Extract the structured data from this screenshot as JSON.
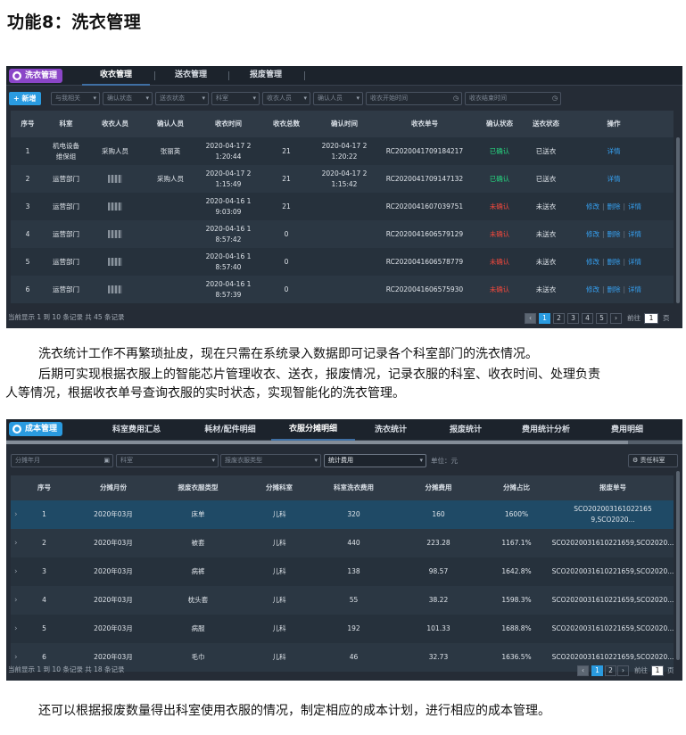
{
  "heading": "功能8：洗衣管理",
  "p1": {
    "badge": "洗衣管理",
    "tabs": [
      "收衣管理",
      "送衣管理",
      "报废管理"
    ],
    "add_btn": "+ 新增",
    "filters": [
      "与我相关",
      "确认状态",
      "送衣状态",
      "科室",
      "收衣人员",
      "确认人员",
      "收衣开始时间",
      "收衣结束时间"
    ],
    "headers": [
      "序号",
      "科室",
      "收衣人员",
      "确认人员",
      "收衣时间",
      "收衣总数",
      "确认时间",
      "收衣单号",
      "确认状态",
      "送衣状态",
      "操作"
    ],
    "rows": [
      {
        "no": "1",
        "dept": "机电设备\n维保组",
        "recv": "采购人员",
        "confirm": "张丽英",
        "time": "2020-04-17 2\n1:20:44",
        "total": "21",
        "ctime": "2020-04-17 2\n1:20:22",
        "order": "RC2020041709184217",
        "cstat": "已确认",
        "sstat": "已送衣",
        "ops": [
          "详情"
        ]
      },
      {
        "no": "2",
        "dept": "运营部门",
        "recv": "",
        "confirm": "采购人员",
        "time": "2020-04-17 2\n1:15:49",
        "total": "21",
        "ctime": "2020-04-17 2\n1:15:42",
        "order": "RC2020041709147132",
        "cstat": "已确认",
        "sstat": "已送衣",
        "ops": [
          "详情"
        ]
      },
      {
        "no": "3",
        "dept": "运营部门",
        "recv": "",
        "confirm": "",
        "time": "2020-04-16 1\n9:03:09",
        "total": "21",
        "ctime": "",
        "order": "RC2020041607039751",
        "cstat": "未确认",
        "sstat": "未送衣",
        "ops": [
          "修改",
          "删除",
          "详情"
        ]
      },
      {
        "no": "4",
        "dept": "运营部门",
        "recv": "",
        "confirm": "",
        "time": "2020-04-16 1\n8:57:42",
        "total": "0",
        "ctime": "",
        "order": "RC2020041606579129",
        "cstat": "未确认",
        "sstat": "未送衣",
        "ops": [
          "修改",
          "删除",
          "详情"
        ]
      },
      {
        "no": "5",
        "dept": "运营部门",
        "recv": "",
        "confirm": "",
        "time": "2020-04-16 1\n8:57:40",
        "total": "0",
        "ctime": "",
        "order": "RC2020041606578779",
        "cstat": "未确认",
        "sstat": "未送衣",
        "ops": [
          "修改",
          "删除",
          "详情"
        ]
      },
      {
        "no": "6",
        "dept": "运营部门",
        "recv": "",
        "confirm": "",
        "time": "2020-04-16 1\n8:57:39",
        "total": "0",
        "ctime": "",
        "order": "RC2020041606575930",
        "cstat": "未确认",
        "sstat": "未送衣",
        "ops": [
          "修改",
          "删除",
          "详情"
        ]
      }
    ],
    "footer": "当前显示 1 到 10 条记录 共 45 条记录",
    "pages": [
      "1",
      "2",
      "3",
      "4",
      "5"
    ],
    "goto": "前往",
    "goto_val": "1",
    "page_unit": "页"
  },
  "para1": "洗衣统计工作不再繁琐扯皮，现在只需在系统录入数据即可记录各个科室部门的洗衣情况。",
  "para2a": "后期可实现根据衣服上的智能芯片管理收衣、送衣，报废情况，记录衣服的科室、收衣时间、处理负责",
  "para2b": "人等情况，根据收衣单号查询衣服的实时状态，实现智能化的洗衣管理。",
  "p2": {
    "badge": "成本管理",
    "tabs": [
      "科室费用汇总",
      "耗材/配件明细",
      "衣服分摊明细",
      "洗衣统计",
      "报废统计",
      "费用统计分析",
      "费用明细"
    ],
    "filters": [
      "分摊年月",
      "科室",
      "报废衣服类型",
      "统计费用"
    ],
    "unit_label": "单位：元",
    "special_btn": "责任科室",
    "headers": [
      "序号",
      "分摊月份",
      "报废衣服类型",
      "分摊科室",
      "科室洗衣费用",
      "分摊费用",
      "分摊占比",
      "报废单号"
    ],
    "rows": [
      {
        "no": "1",
        "month": "2020年03月",
        "type": "床单",
        "dept": "儿科",
        "fee": "320",
        "share": "160",
        "ratio": "1600%",
        "order": "SCO202003161022165​9,SCO2020..."
      },
      {
        "no": "2",
        "month": "2020年03月",
        "type": "被套",
        "dept": "儿科",
        "fee": "440",
        "share": "223.28",
        "ratio": "1167.1%",
        "order": "SCO2020031610221659,SCO2020..."
      },
      {
        "no": "3",
        "month": "2020年03月",
        "type": "病裤",
        "dept": "儿科",
        "fee": "138",
        "share": "98.57",
        "ratio": "1642.8%",
        "order": "SCO2020031610221659,SCO2020..."
      },
      {
        "no": "4",
        "month": "2020年03月",
        "type": "枕头套",
        "dept": "儿科",
        "fee": "55",
        "share": "38.22",
        "ratio": "1598.3%",
        "order": "SCO2020031610221659,SCO2020..."
      },
      {
        "no": "5",
        "month": "2020年03月",
        "type": "病服",
        "dept": "儿科",
        "fee": "192",
        "share": "101.33",
        "ratio": "1688.8%",
        "order": "SCO2020031610221659,SCO2020..."
      },
      {
        "no": "6",
        "month": "2020年03月",
        "type": "毛巾",
        "dept": "儿科",
        "fee": "46",
        "share": "32.73",
        "ratio": "1636.5%",
        "order": "SCO2020031610221659,SCO2020..."
      }
    ],
    "footer": "当前显示 1 到 10 条记录 共 18 条记录",
    "pages": [
      "1",
      "2"
    ],
    "goto": "前往",
    "goto_val": "1",
    "page_unit": "页"
  },
  "para3": "还可以根据报废数量得出科室使用衣服的情况，制定相应的成本计划，进行相应的成本管理。"
}
